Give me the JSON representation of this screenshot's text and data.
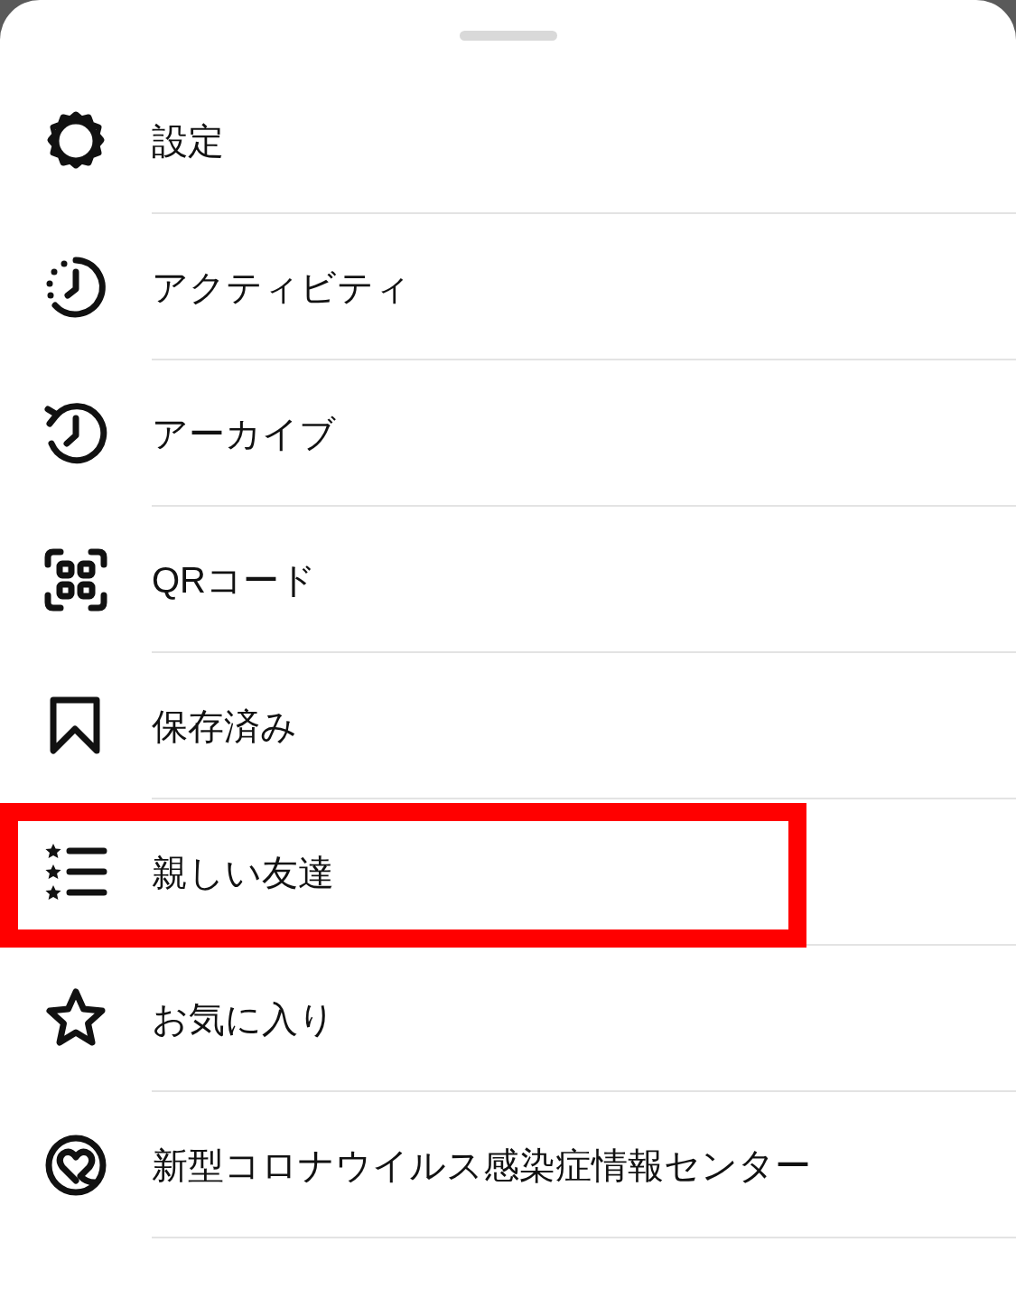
{
  "menu": [
    {
      "kind": "settings",
      "label": "設定",
      "highlighted": false
    },
    {
      "kind": "activity",
      "label": "アクティビティ",
      "highlighted": false
    },
    {
      "kind": "archive",
      "label": "アーカイブ",
      "highlighted": false
    },
    {
      "kind": "qr",
      "label": "QRコード",
      "highlighted": false
    },
    {
      "kind": "saved",
      "label": "保存済み",
      "highlighted": false
    },
    {
      "kind": "close_friends",
      "label": "親しい友達",
      "highlighted": true
    },
    {
      "kind": "favorites",
      "label": "お気に入り",
      "highlighted": false
    },
    {
      "kind": "covid",
      "label": "新型コロナウイルス感染症情報センター",
      "highlighted": false
    }
  ]
}
